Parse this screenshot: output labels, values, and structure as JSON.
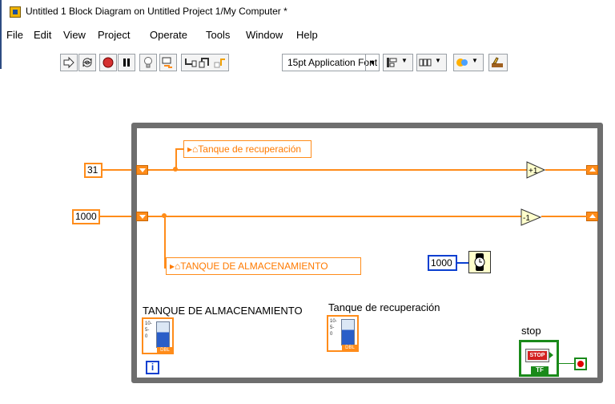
{
  "window": {
    "title": "Untitled 1 Block Diagram on Untitled Project 1/My Computer *"
  },
  "menu": [
    "File",
    "Edit",
    "View",
    "Project",
    "Operate",
    "Tools",
    "Window",
    "Help"
  ],
  "toolbar": {
    "font": "15pt Application Font",
    "icons": [
      "run-arrow-icon",
      "run-continuously-icon",
      "abort-icon",
      "pause-icon",
      "highlight-execution-icon",
      "retain-wire-values-icon",
      "step-into-icon",
      "step-over-icon",
      "step-out-icon",
      "align-objects-icon",
      "distribute-objects-icon",
      "reorder-icon",
      "clean-up-diagram-icon"
    ]
  },
  "diagram": {
    "const_31": "31",
    "const_1000_left": "1000",
    "const_1000_wait": "1000",
    "local_var_recuperacion": "Tanque de recuperación",
    "local_var_almacenamiento": "TANQUE DE ALMACENAMIENTO",
    "indicator_almacenamiento_label": "TANQUE DE ALMACENAMIENTO",
    "indicator_recuperacion_label": "Tanque de recuperación",
    "increment_label": "+1",
    "decrement_label": "-1",
    "stop_label": "stop",
    "stop_button_text": "STOP",
    "tf_text": "TF",
    "iteration_text": "i",
    "tank_scale": [
      "10-",
      "5-",
      "0"
    ],
    "dbl_text": "DBL"
  },
  "colors": {
    "numeric_wire": "#ff8c1a",
    "integer_wire": "#0a3fd0",
    "boolean_wire": "#1a8a1a",
    "loop_border": "#6e6e6e"
  }
}
